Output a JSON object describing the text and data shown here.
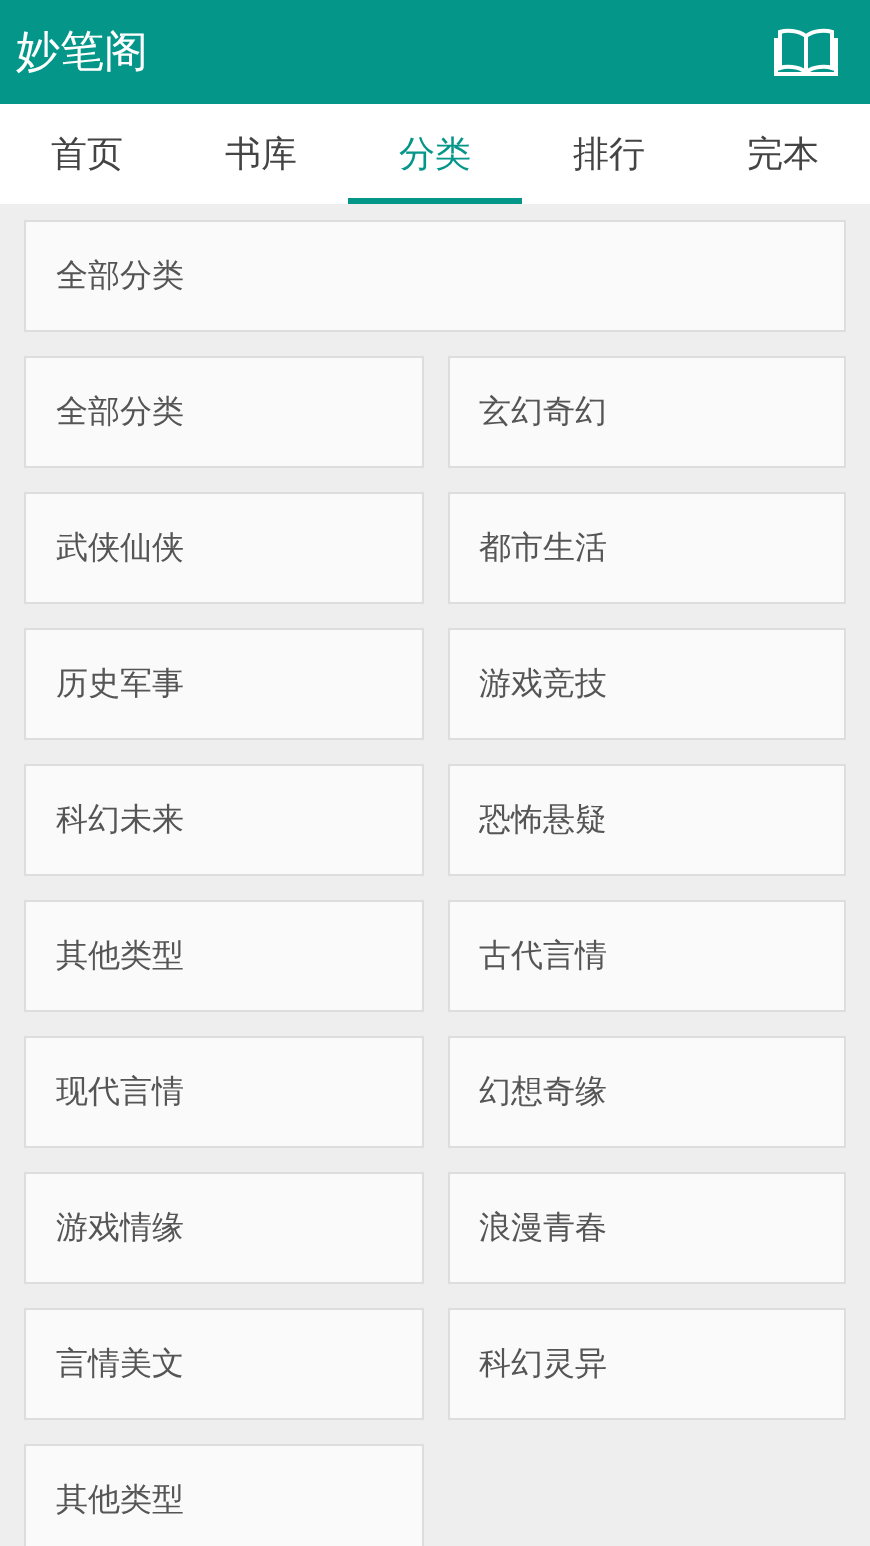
{
  "header": {
    "title": "妙笔阁"
  },
  "tabs": [
    {
      "label": "首页",
      "selected": false
    },
    {
      "label": "书库",
      "selected": false
    },
    {
      "label": "分类",
      "selected": true
    },
    {
      "label": "排行",
      "selected": false
    },
    {
      "label": "完本",
      "selected": false
    }
  ],
  "all_category": "全部分类",
  "categories": [
    "全部分类",
    "玄幻奇幻",
    "武侠仙侠",
    "都市生活",
    "历史军事",
    "游戏竞技",
    "科幻未来",
    "恐怖悬疑",
    "其他类型",
    "古代言情",
    "现代言情",
    "幻想奇缘",
    "游戏情缘",
    "浪漫青春",
    "言情美文",
    "科幻灵异",
    "其他类型"
  ]
}
